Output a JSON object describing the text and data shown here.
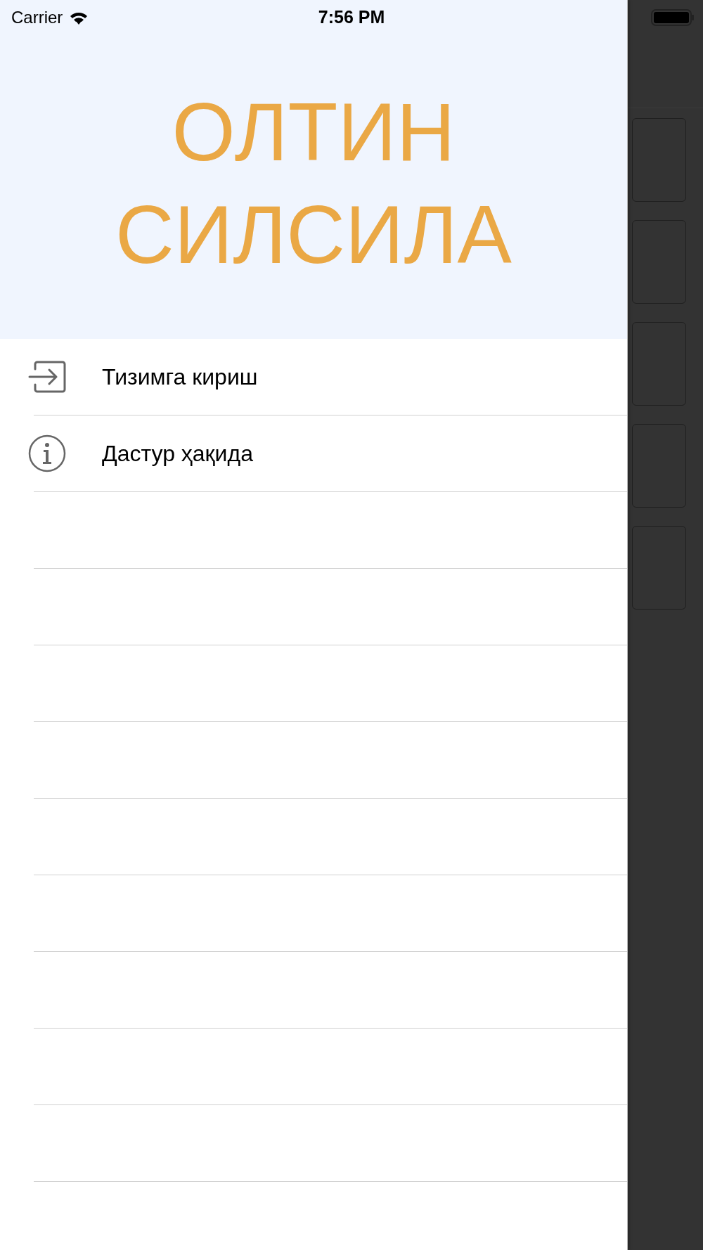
{
  "status_bar": {
    "carrier": "Carrier",
    "time": "7:56 PM"
  },
  "drawer": {
    "title": "ОЛТИН СИЛСИЛА",
    "items": [
      {
        "label": "Тизимга кириш",
        "kind": "login"
      },
      {
        "label": "Дастур ҳақида",
        "kind": "info"
      }
    ]
  }
}
